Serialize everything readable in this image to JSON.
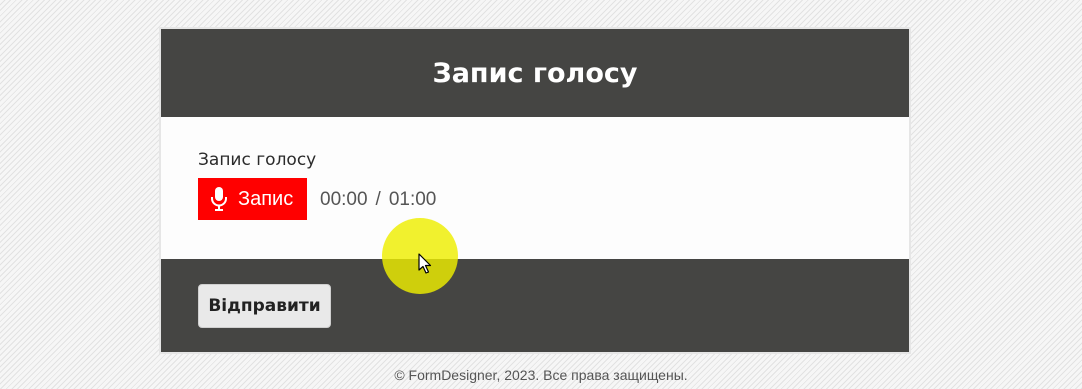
{
  "form": {
    "title": "Запис голосу",
    "field_label": "Запис голосу",
    "record_button_label": "Запис",
    "timer": {
      "current": "00:00",
      "separator": "/",
      "max": "01:00"
    },
    "submit_label": "Відправити"
  },
  "footer": {
    "copyright": "© FormDesigner, 2023. Все права защищены."
  },
  "icons": {
    "record": "microphone-icon",
    "pointer": "mouse-pointer-icon"
  },
  "colors": {
    "header_bg": "#454543",
    "record_button_bg": "#ff0000",
    "cursor_highlight": "#eeee00"
  }
}
